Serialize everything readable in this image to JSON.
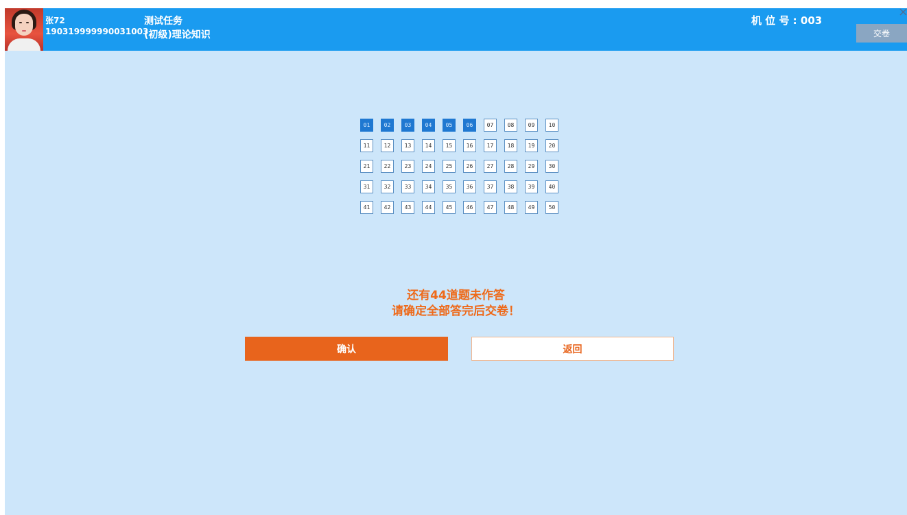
{
  "header": {
    "user_name": "张72",
    "user_id": "190319999990031003",
    "task_title": "测试任务",
    "task_subtitle": "(初级)理论知识",
    "seat_label": "机 位 号 : 003",
    "submit_label": "交卷"
  },
  "questions": [
    {
      "num": "01",
      "answered": true
    },
    {
      "num": "02",
      "answered": true
    },
    {
      "num": "03",
      "answered": true
    },
    {
      "num": "04",
      "answered": true
    },
    {
      "num": "05",
      "answered": true
    },
    {
      "num": "06",
      "answered": true
    },
    {
      "num": "07",
      "answered": false
    },
    {
      "num": "08",
      "answered": false
    },
    {
      "num": "09",
      "answered": false
    },
    {
      "num": "10",
      "answered": false
    },
    {
      "num": "11",
      "answered": false
    },
    {
      "num": "12",
      "answered": false
    },
    {
      "num": "13",
      "answered": false
    },
    {
      "num": "14",
      "answered": false
    },
    {
      "num": "15",
      "answered": false
    },
    {
      "num": "16",
      "answered": false
    },
    {
      "num": "17",
      "answered": false
    },
    {
      "num": "18",
      "answered": false
    },
    {
      "num": "19",
      "answered": false
    },
    {
      "num": "20",
      "answered": false
    },
    {
      "num": "21",
      "answered": false
    },
    {
      "num": "22",
      "answered": false
    },
    {
      "num": "23",
      "answered": false
    },
    {
      "num": "24",
      "answered": false
    },
    {
      "num": "25",
      "answered": false
    },
    {
      "num": "26",
      "answered": false
    },
    {
      "num": "27",
      "answered": false
    },
    {
      "num": "28",
      "answered": false
    },
    {
      "num": "29",
      "answered": false
    },
    {
      "num": "30",
      "answered": false
    },
    {
      "num": "31",
      "answered": false
    },
    {
      "num": "32",
      "answered": false
    },
    {
      "num": "33",
      "answered": false
    },
    {
      "num": "34",
      "answered": false
    },
    {
      "num": "35",
      "answered": false
    },
    {
      "num": "36",
      "answered": false
    },
    {
      "num": "37",
      "answered": false
    },
    {
      "num": "38",
      "answered": false
    },
    {
      "num": "39",
      "answered": false
    },
    {
      "num": "40",
      "answered": false
    },
    {
      "num": "41",
      "answered": false
    },
    {
      "num": "42",
      "answered": false
    },
    {
      "num": "43",
      "answered": false
    },
    {
      "num": "44",
      "answered": false
    },
    {
      "num": "45",
      "answered": false
    },
    {
      "num": "46",
      "answered": false
    },
    {
      "num": "47",
      "answered": false
    },
    {
      "num": "48",
      "answered": false
    },
    {
      "num": "49",
      "answered": false
    },
    {
      "num": "50",
      "answered": false
    }
  ],
  "dialog": {
    "line1": "还有44道题未作答",
    "line2": "请确定全部答完后交卷！",
    "confirm_label": "确认",
    "back_label": "返回"
  },
  "colors": {
    "header_bg": "#1a9bf0",
    "page_bg": "#cde6fa",
    "answered_bg": "#1f78d1",
    "accent_orange": "#e8641c"
  },
  "icons": {
    "corner": "close-corner-icon"
  }
}
